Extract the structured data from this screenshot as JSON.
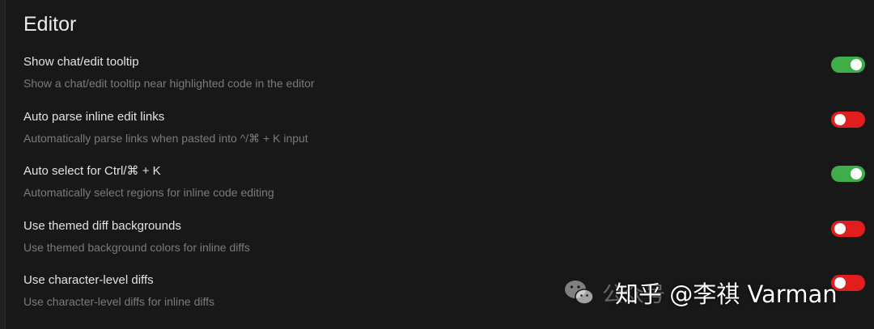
{
  "section": {
    "title": "Editor"
  },
  "settings": [
    {
      "title": "Show chat/edit tooltip",
      "description": "Show a chat/edit tooltip near highlighted code in the editor",
      "enabled": true
    },
    {
      "title": "Auto parse inline edit links",
      "description": "Automatically parse links when pasted into ^/⌘ + K input",
      "enabled": false
    },
    {
      "title": "Auto select for Ctrl/⌘ + K",
      "description": "Automatically select regions for inline code editing",
      "enabled": true
    },
    {
      "title": "Use themed diff backgrounds",
      "description": "Use themed background colors for inline diffs",
      "enabled": false
    },
    {
      "title": "Use character-level diffs",
      "description": "Use character-level diffs for inline diffs",
      "enabled": false
    }
  ],
  "colors": {
    "toggle_on": "#3fae49",
    "toggle_off": "#e11d1d",
    "background": "#181818"
  },
  "watermark": {
    "faint_text": "公众号",
    "text": "知乎 @李祺 Varman",
    "icon": "wechat-icon"
  }
}
